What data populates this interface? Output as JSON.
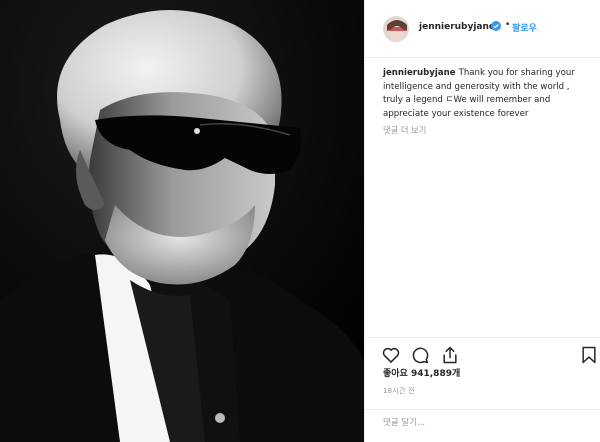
{
  "post": {
    "username": "jenn ierubyjane",
    "follow_label": "팔로우",
    "separator": "•",
    "caption_user": "jennierubyjane",
    "caption_text": "Thank you for sharing your intelligence and generosity with the world , truly a legend ㄷWe will remember and appreciate your existence forever",
    "more_comments": "댓글 더 보기",
    "likes": "좋아요 941,889개",
    "time": "18시간 전",
    "comment_placeholder": "댓글 달기..."
  },
  "icons": {
    "verified": "verified-badge-icon",
    "like": "heart-icon",
    "comment": "comment-icon",
    "share": "share-icon",
    "save": "bookmark-icon"
  },
  "colors": {
    "link": "#3897f0",
    "text": "#262626",
    "muted": "#999999"
  }
}
